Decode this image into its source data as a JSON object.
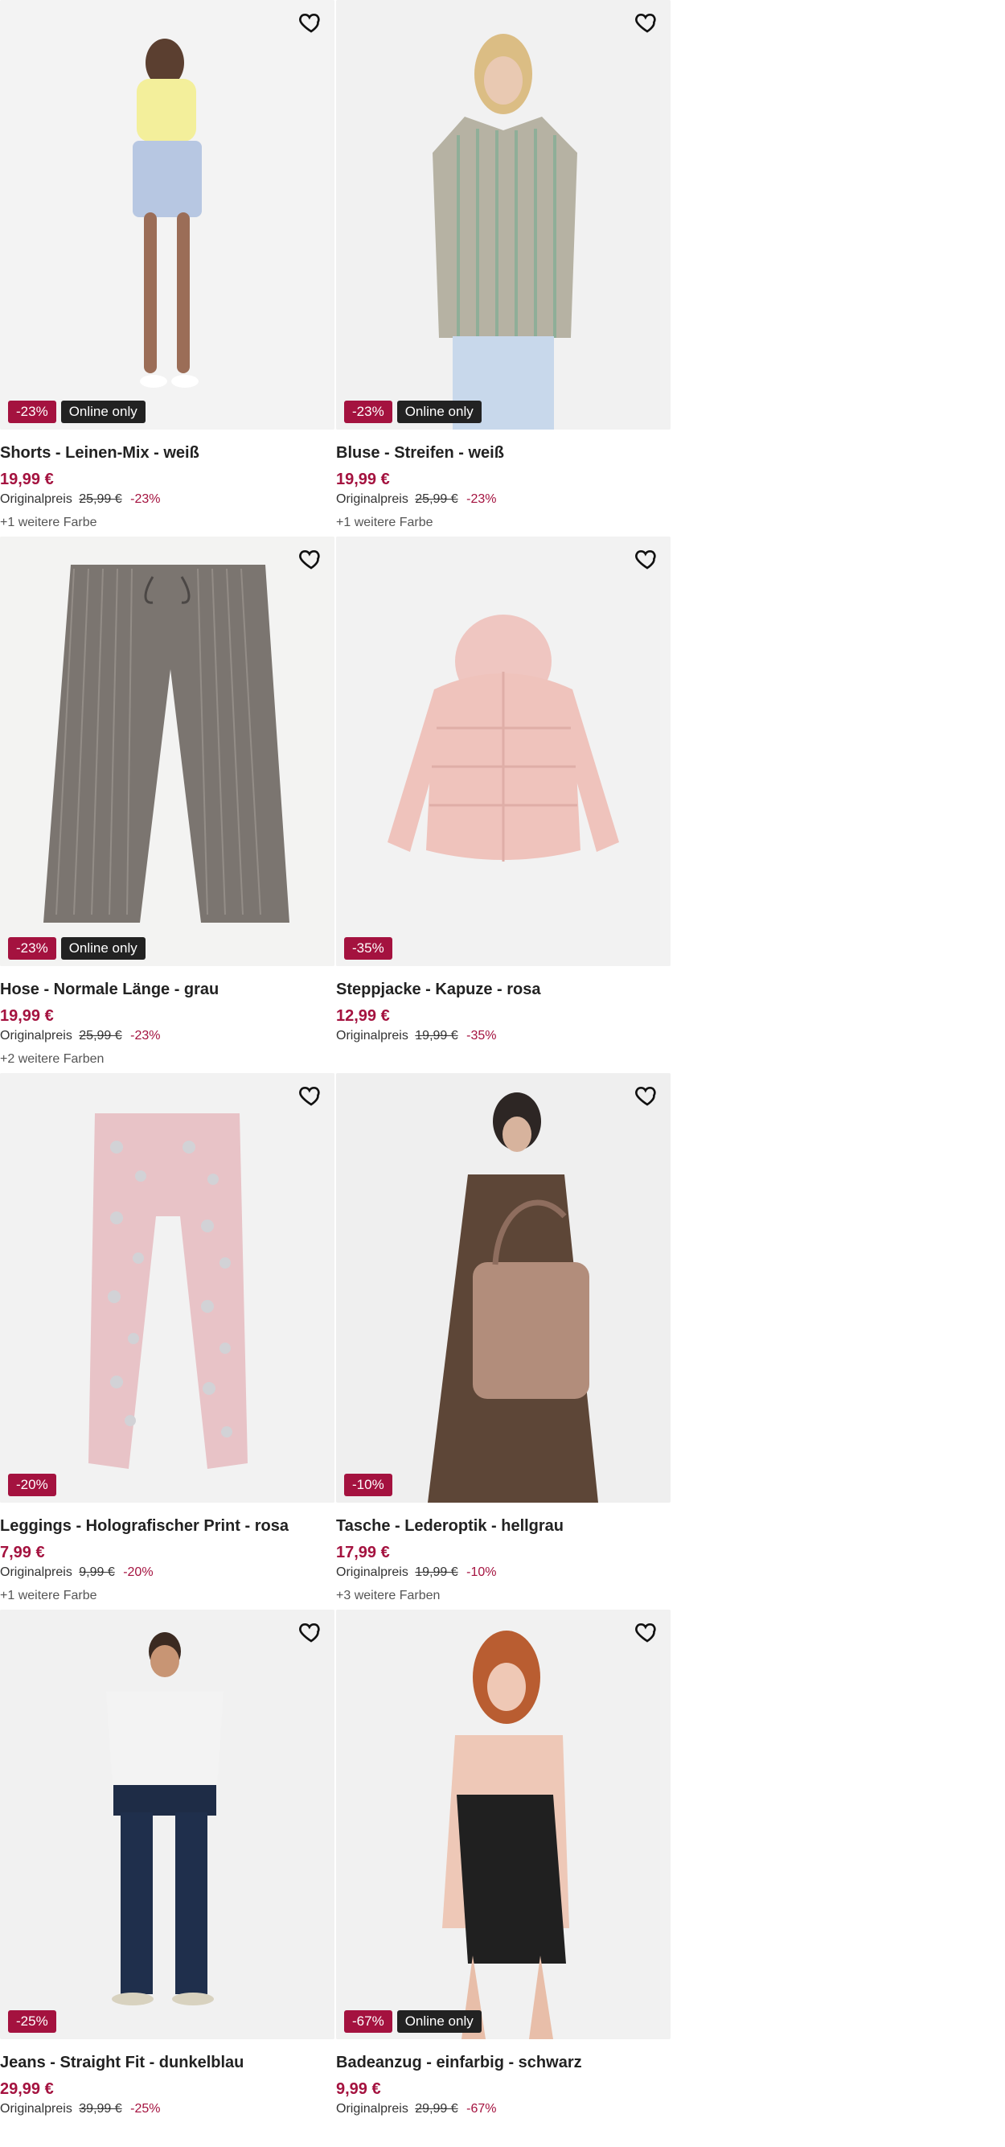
{
  "products": [
    {
      "title": "Shorts - Leinen-Mix - weiß",
      "price": "19,99 €",
      "original_label": "Originalpreis",
      "original_price": "25,99 €",
      "discount": "-23%",
      "online_only": "Online only",
      "colors_text": "+1 weitere Farbe"
    },
    {
      "title": "Bluse - Streifen - weiß",
      "price": "19,99 €",
      "original_label": "Originalpreis",
      "original_price": "25,99 €",
      "discount": "-23%",
      "online_only": "Online only",
      "colors_text": "+1 weitere Farbe"
    },
    {
      "title": "Hose - Normale Länge - grau",
      "price": "19,99 €",
      "original_label": "Originalpreis",
      "original_price": "25,99 €",
      "discount": "-23%",
      "online_only": "Online only",
      "colors_text": "+2 weitere Farben"
    },
    {
      "title": "Steppjacke - Kapuze - rosa",
      "price": "12,99 €",
      "original_label": "Originalpreis",
      "original_price": "19,99 €",
      "discount": "-35%",
      "online_only": "",
      "colors_text": ""
    },
    {
      "title": "Leggings - Holografischer Print - rosa",
      "price": "7,99 €",
      "original_label": "Originalpreis",
      "original_price": "9,99 €",
      "discount": "-20%",
      "online_only": "",
      "colors_text": "+1 weitere Farbe"
    },
    {
      "title": "Tasche - Lederoptik - hellgrau",
      "price": "17,99 €",
      "original_label": "Originalpreis",
      "original_price": "19,99 €",
      "discount": "-10%",
      "online_only": "",
      "colors_text": "+3 weitere Farben"
    },
    {
      "title": "Jeans - Straight Fit - dunkelblau",
      "price": "29,99 €",
      "original_label": "Originalpreis",
      "original_price": "39,99 €",
      "discount": "-25%",
      "online_only": "",
      "colors_text": ""
    },
    {
      "title": "Badeanzug - einfarbig - schwarz",
      "price": "9,99 €",
      "original_label": "Originalpreis",
      "original_price": "29,99 €",
      "discount": "-67%",
      "online_only": "Online only",
      "colors_text": ""
    }
  ],
  "icons": {
    "favorite": "heart-icon"
  },
  "colors": {
    "accent": "#a4123f",
    "badge_dark": "#222222",
    "image_bg": "#f2f2f2"
  }
}
